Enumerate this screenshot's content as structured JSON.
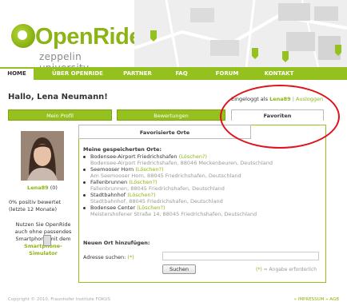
{
  "header": {
    "logo_title": "OpenRide",
    "logo_subtitle": "zeppelin university"
  },
  "nav": {
    "items": [
      "HOME",
      "ÜBER OPENRIDE",
      "PARTNER",
      "FAQ",
      "FORUM",
      "KONTAKT"
    ],
    "active": "HOME"
  },
  "page": {
    "greeting": "Hallo, Lena Neumann!",
    "login_prefix": "Eingeloggt als",
    "login_user": "Lena89",
    "login_separator": "|",
    "logout_label": "Ausloggen"
  },
  "tabs": [
    "Mein Profil",
    "Bewertungen",
    "Favoriten"
  ],
  "sidebar": {
    "username": "Lena89",
    "rating_count": "(0)",
    "rating_text": "0% positiv bewertet (letzte 12 Monate)",
    "promo_text": "Nutzen Sie OpenRide auch ohne passendes Smartphone mit dem",
    "promo_link": "Smartphone-Simulator"
  },
  "content": {
    "title": "Favorisierte Orte",
    "saved_heading": "Meine gespeicherten Orte:",
    "delete_label": "(Löschen?)",
    "places": [
      {
        "name": "Bodensee-Airport Friedrichshafen",
        "address": "Bodensee-Airport Friedrichshafen, 88046 Meckenbeuren, Deutschland"
      },
      {
        "name": "Seemooser Horn",
        "address": "Am Seemooser Horn, 88045 Friedrichshafen, Deutschland"
      },
      {
        "name": "Fallenbrunnen",
        "address": "Fallenbrunnen, 88045 Friedrichshafen, Deutschland"
      },
      {
        "name": "Stadtbahnhof",
        "address": "Stadtbahnhof, 88045 Friedrichshafen, Deutschland"
      },
      {
        "name": "Bodensee Center",
        "address": "Meistershofener Straße 14, 88045 Friedrichshafen, Deutschland"
      }
    ],
    "add_heading": "Neuen Ort hinzufügen:",
    "address_label": "Adresse suchen:",
    "required_marker": "(*)",
    "address_value": "",
    "search_button": "Suchen",
    "required_note": "= Angabe erforderlich"
  },
  "footer": {
    "copyright": "Copyright © 2010, Fraunhofer Institute FOKUS",
    "links": "» IMPRESSUM » AGB"
  },
  "colors": {
    "brand_green": "#95c11f",
    "annotation_red": "#e0121b"
  },
  "icons": [
    "openride-logo-icon",
    "map-marker-icon",
    "smartphone-icon"
  ]
}
